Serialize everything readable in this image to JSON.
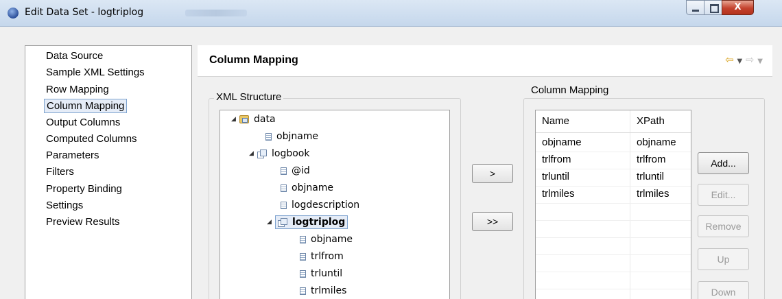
{
  "window": {
    "title": "Edit Data Set - logtriplog",
    "close_glyph": "X"
  },
  "nav": {
    "items": [
      "Data Source",
      "Sample XML Settings",
      "Row Mapping",
      "Column Mapping",
      "Output Columns",
      "Computed Columns",
      "Parameters",
      "Filters",
      "Property Binding",
      "Settings",
      "Preview Results"
    ],
    "selected": "Column Mapping"
  },
  "page": {
    "title": "Column Mapping",
    "back_arrow": "⇦",
    "forward_arrow": "⇨",
    "caret": "▼"
  },
  "xml_structure": {
    "label": "XML Structure",
    "tree": {
      "root": "data",
      "root_child": "objname",
      "logbook": "logbook",
      "logbook_children": [
        "@id",
        "objname",
        "logdescription"
      ],
      "logtriplog": "logtriplog",
      "logtriplog_children": [
        "objname",
        "trlfrom",
        "trluntil",
        "trlmiles"
      ]
    }
  },
  "transfer": {
    "add_one": ">",
    "add_all": ">>"
  },
  "column_mapping": {
    "label": "Column Mapping",
    "headers": [
      "Name",
      "XPath"
    ],
    "rows": [
      [
        "objname",
        "objname"
      ],
      [
        "trlfrom",
        "trlfrom"
      ],
      [
        "trluntil",
        "trluntil"
      ],
      [
        "trlmiles",
        "trlmiles"
      ]
    ],
    "buttons": {
      "add": "Add...",
      "edit": "Edit...",
      "remove": "Remove",
      "up": "Up",
      "down": "Down"
    }
  }
}
